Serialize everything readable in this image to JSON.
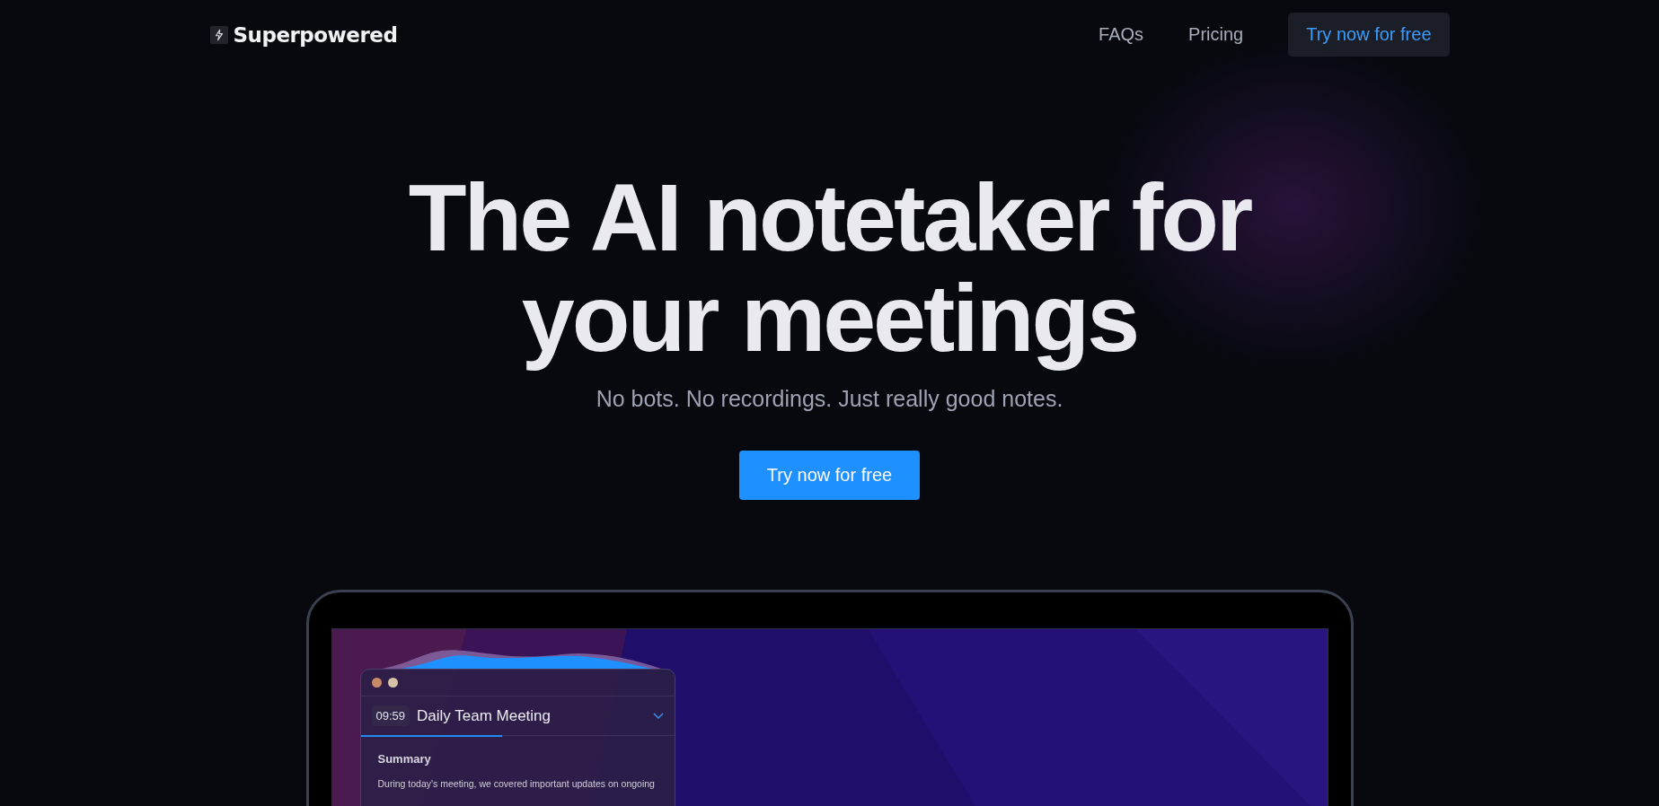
{
  "header": {
    "logo": "Superpowered",
    "nav": [
      {
        "label": "FAQs",
        "kind": "link"
      },
      {
        "label": "Pricing",
        "kind": "link"
      },
      {
        "label": "Try now for free",
        "kind": "button"
      }
    ]
  },
  "hero": {
    "headline": [
      "The AI notetaker for",
      "your meetings"
    ],
    "subtitle": "No bots. No recordings. Just really good notes.",
    "cta": "Try now for free"
  },
  "app_window": {
    "timer": "09:59",
    "title": "Daily Team Meeting",
    "progress": {
      "level": 0.45
    },
    "section_title": "Summary",
    "summary": "During today's meeting, we covered important updates on ongoing"
  }
}
